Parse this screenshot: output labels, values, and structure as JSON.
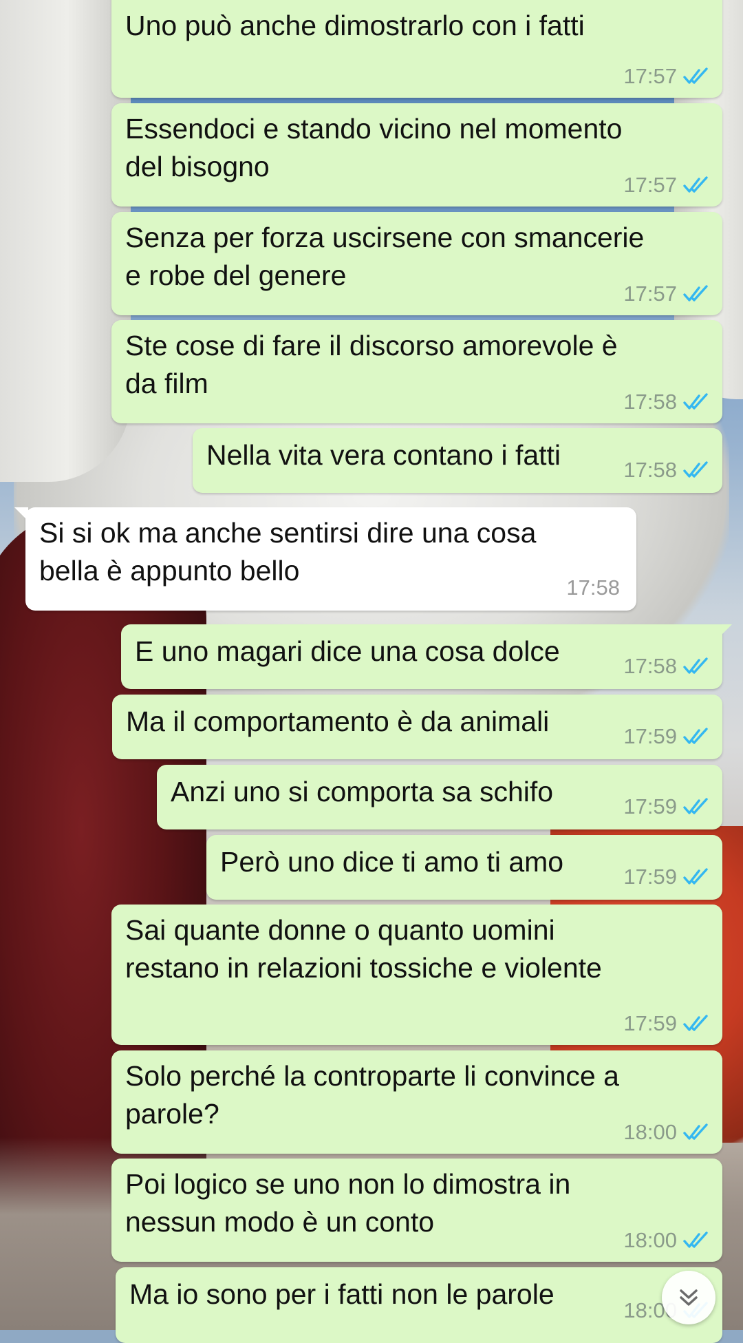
{
  "messages": [
    {
      "text": "Uno può anche dimostrarlo con i fatti",
      "time": "17:57",
      "direction": "out"
    },
    {
      "text": "Essendoci e stando vicino nel momento\ndel bisogno",
      "time": "17:57",
      "direction": "out"
    },
    {
      "text": "Senza per forza uscirsene con smancerie\ne robe del genere",
      "time": "17:57",
      "direction": "out"
    },
    {
      "text": "Ste cose di fare il discorso amorevole è\nda film",
      "time": "17:58",
      "direction": "out"
    },
    {
      "text": "Nella vita vera contano i fatti",
      "time": "17:58",
      "direction": "out"
    },
    {
      "text": "Si si ok ma anche sentirsi dire una cosa\nbella è appunto bello",
      "time": "17:58",
      "direction": "in"
    },
    {
      "text": "E uno magari dice una cosa dolce",
      "time": "17:58",
      "direction": "out"
    },
    {
      "text": "Ma il comportamento è da animali",
      "time": "17:59",
      "direction": "out"
    },
    {
      "text": "Anzi uno si comporta sa schifo",
      "time": "17:59",
      "direction": "out"
    },
    {
      "text": "Però uno dice ti amo ti amo",
      "time": "17:59",
      "direction": "out"
    },
    {
      "text": "Sai quante donne o quanto uomini\nrestano in relazioni tossiche e violente",
      "time": "17:59",
      "direction": "out"
    },
    {
      "text": "Solo perché la controparte li convince a\nparole?",
      "time": "18:00",
      "direction": "out"
    },
    {
      "text": "Poi logico se uno non lo dimostra in\nnessun modo è un conto",
      "time": "18:00",
      "direction": "out"
    },
    {
      "text": "Ma io sono per i fatti non le parole",
      "time": "18:00",
      "direction": "out"
    }
  ],
  "colors": {
    "outgoing_bubble": "#dcf8c6",
    "incoming_bubble": "#ffffff",
    "read_ticks": "#34b7f1"
  },
  "icons": {
    "read_status": "double-check-icon",
    "scroll_down": "double-chevron-down-icon"
  }
}
